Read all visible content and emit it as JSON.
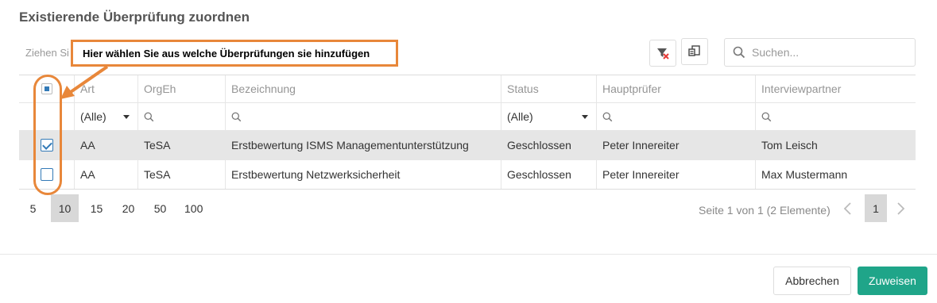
{
  "dialog": {
    "title": "Existierende Überprüfung zuordnen",
    "drag_hint": "Ziehen Si"
  },
  "annotation": {
    "text": "Hier wählen Sie aus welche Überprüfungen sie hinzufügen",
    "color": "#e8873a"
  },
  "search": {
    "placeholder": "Suchen..."
  },
  "columns": [
    "Art",
    "OrgEh",
    "Bezeichnung",
    "Status",
    "Hauptprüfer",
    "Interviewpartner"
  ],
  "filters": {
    "art": "(Alle)",
    "status": "(Alle)"
  },
  "rows": [
    {
      "selected": true,
      "art": "AA",
      "orgeh": "TeSA",
      "bezeichnung": "Erstbewertung ISMS Managementunterstützung",
      "status": "Geschlossen",
      "hauptpruefer": "Peter Innereiter",
      "interviewpartner": "Tom Leisch"
    },
    {
      "selected": false,
      "art": "AA",
      "orgeh": "TeSA",
      "bezeichnung": "Erstbewertung Netzwerksicherheit",
      "status": "Geschlossen",
      "hauptpruefer": "Peter Innereiter",
      "interviewpartner": "Max Mustermann"
    }
  ],
  "pager": {
    "sizes": [
      "5",
      "10",
      "15",
      "20",
      "50",
      "100"
    ],
    "active_size": "10",
    "info": "Seite 1 von 1 (2 Elemente)",
    "current_page": "1"
  },
  "buttons": {
    "cancel": "Abbrechen",
    "assign": "Zuweisen"
  },
  "colors": {
    "accent": "#1fa589",
    "checkbox": "#337ab7",
    "selected_row": "#e6e6e6"
  }
}
